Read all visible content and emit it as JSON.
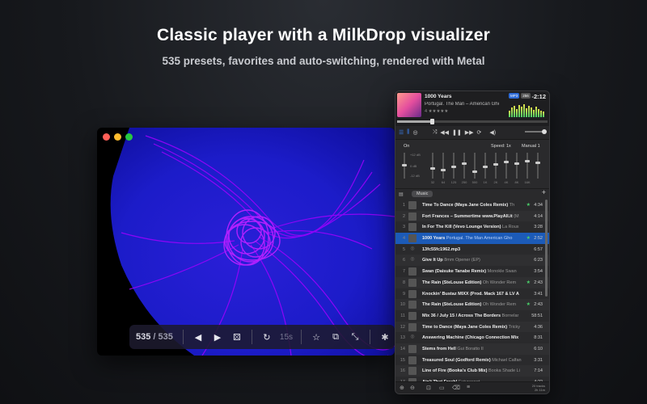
{
  "headline": "Classic player with a MilkDrop visualizer",
  "subline": "535 presets, favorites and auto-switching, rendered with Metal",
  "visualizer": {
    "preset_current": "535",
    "preset_total": "535",
    "interval": "15s",
    "colors": {
      "background": "#1c1cc9",
      "accent": "#a100ff"
    },
    "icons": [
      "previous-icon",
      "next-icon",
      "shuffle-icon",
      "history-icon",
      "star-icon",
      "copy-icon",
      "fullscreen-icon",
      "bug-icon"
    ]
  },
  "player": {
    "now_playing": {
      "title": "1000 Years",
      "artist_album": "Portugal. The Man – American Ghet",
      "rating_prefix": "4",
      "format_a": "MP3",
      "format_b": "256",
      "remaining": "-2:12",
      "progress": 0.22
    },
    "eq": {
      "on_label": "On",
      "speed_label": "Speed: 1x",
      "manual_label": "Manual 1",
      "db_labels": [
        "+12 dB",
        "0 dB",
        "-12 dB"
      ],
      "freqs": [
        "32",
        "64",
        "125",
        "250",
        "500",
        "1K",
        "2K",
        "4K",
        "8K",
        "16K"
      ]
    },
    "playlist_tab": "Music",
    "tracks": [
      {
        "n": "1",
        "title": "Time To Dance (Maya Jane Coles Remix)",
        "artist": "Th",
        "fav": true,
        "dur": "4:34"
      },
      {
        "n": "2",
        "title": "Fort Frances – Summertime www.PlayAll.it",
        "artist": "(M",
        "fav": false,
        "dur": "4:14"
      },
      {
        "n": "3",
        "title": "In For The Kill (Vevo Lounge Version)",
        "artist": "La Roux",
        "fav": false,
        "dur": "3:28"
      },
      {
        "n": "4",
        "title": "1000 Years",
        "artist": "Portugal. The Man  American Gho",
        "fav": true,
        "dur": "2:52",
        "selected": true
      },
      {
        "n": "5",
        "title": "13fc55fc1962.mp3",
        "artist": "",
        "fav": false,
        "dur": "6:57"
      },
      {
        "n": "6",
        "title": "Give It Up",
        "artist": "8mm  Opener (EP)",
        "fav": false,
        "dur": "6:23"
      },
      {
        "n": "7",
        "title": "Swan (Daisuke Tanabe Remix)",
        "artist": "Monokle  Swan",
        "fav": false,
        "dur": "3:54"
      },
      {
        "n": "8",
        "title": "The Rain (SteLouse Edition)",
        "artist": "Oh Wonder  Rem",
        "fav": true,
        "dur": "2:43"
      },
      {
        "n": "9",
        "title": "Knockin' Bustaz MIXX (Prod. Mack 167 & LV A",
        "artist": "",
        "fav": false,
        "dur": "3:41"
      },
      {
        "n": "10",
        "title": "The Rain (SteLouse Edition)",
        "artist": "Oh Wonder  Rem",
        "fav": true,
        "dur": "2:43"
      },
      {
        "n": "11",
        "title": "Mix 36 / July 15 / Across The Borders",
        "artist": "Bornelar",
        "fav": false,
        "dur": "58:51"
      },
      {
        "n": "12",
        "title": "Time to Dance (Maya Jane Coles Remix)",
        "artist": "Tricky",
        "fav": false,
        "dur": "4:36"
      },
      {
        "n": "13",
        "title": "Answering Machine (Chicago Connection Mix",
        "artist": "",
        "fav": false,
        "dur": "8:31"
      },
      {
        "n": "14",
        "title": "Stems from Hell",
        "artist": "Gui Boratto  II",
        "fav": false,
        "dur": "6:10"
      },
      {
        "n": "15",
        "title": "Treasured Soul (Godford Remix)",
        "artist": "Michael Calfan",
        "fav": false,
        "dur": "3:31"
      },
      {
        "n": "16",
        "title": "Line of Fire (Booka's Club Mix)",
        "artist": "Booka Shade  Li",
        "fav": false,
        "dur": "7:14"
      },
      {
        "n": "17",
        "title": "Ain't That Fresh!",
        "artist": "Futuracoot",
        "fav": false,
        "dur": "4:22"
      }
    ],
    "footer_count": "20 tracks",
    "footer_duration": "2h 11m"
  }
}
